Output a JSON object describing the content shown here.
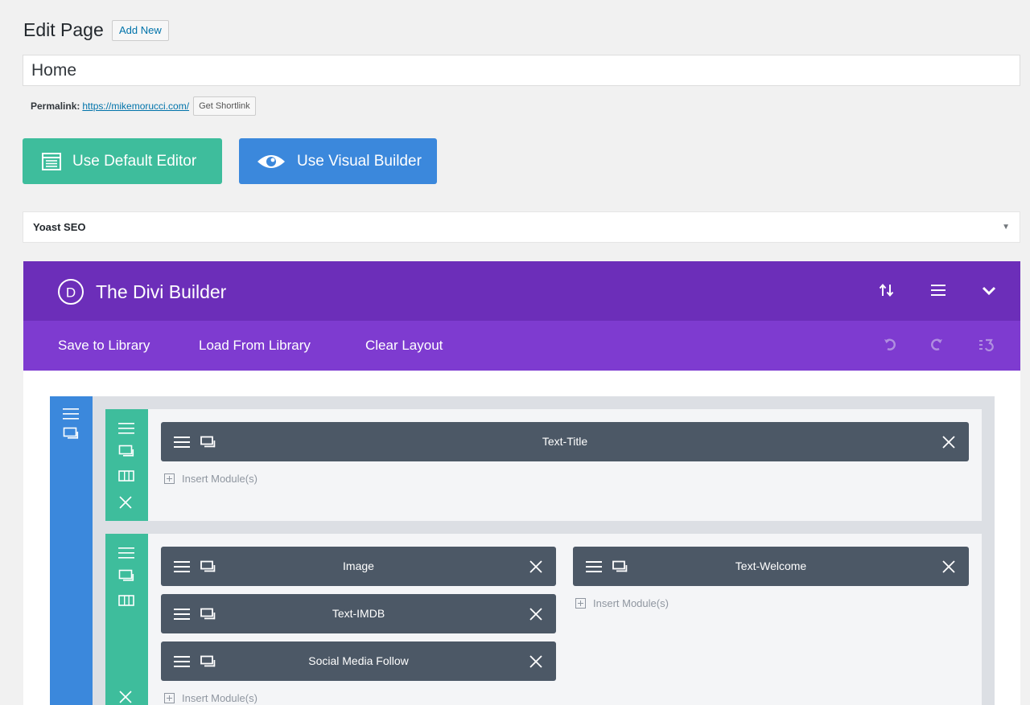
{
  "header": {
    "title": "Edit Page",
    "add_new": "Add New",
    "page_title_value": "Home",
    "permalink_label": "Permalink:",
    "permalink_url": "https://mikemorucci.com/",
    "get_shortlink": "Get Shortlink"
  },
  "editor_buttons": {
    "default_editor": "Use Default Editor",
    "visual_builder": "Use Visual Builder"
  },
  "yoast": {
    "title": "Yoast SEO"
  },
  "divi": {
    "title": "The Divi Builder",
    "logo_letter": "D",
    "toolbar": {
      "save_to_library": "Save to Library",
      "load_from_library": "Load From Library",
      "clear_layout": "Clear Layout"
    },
    "rows": [
      {
        "columns": [
          {
            "modules": [
              "Text-Title"
            ],
            "insert": "Insert Module(s)"
          }
        ]
      },
      {
        "columns": [
          {
            "modules": [
              "Image",
              "Text-IMDB",
              "Social Media Follow"
            ],
            "insert": "Insert Module(s)"
          },
          {
            "modules": [
              "Text-Welcome"
            ],
            "insert": "Insert Module(s)"
          }
        ]
      }
    ]
  },
  "colors": {
    "divi_purple": "#6c2eb9",
    "divi_purple_light": "#7e3bd0",
    "section_blue": "#3b88dc",
    "row_green": "#3ebd9c",
    "module_gray": "#4c5866"
  }
}
